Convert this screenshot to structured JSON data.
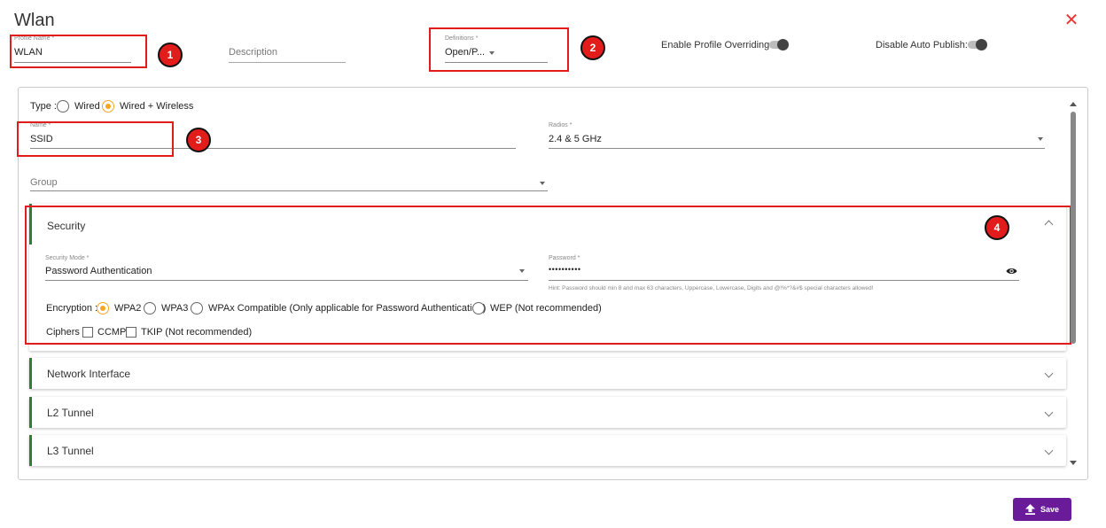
{
  "header": {
    "title": "Wlan",
    "close_glyph": "✕"
  },
  "profile_name": {
    "label": "Profile Name *",
    "value": "WLAN"
  },
  "description": {
    "placeholder": "Description"
  },
  "definitions": {
    "label": "Definitions *",
    "value": "Open/P..."
  },
  "toggles": {
    "profile_overriding": {
      "label": "Enable Profile Overriding:",
      "on": false
    },
    "auto_publish": {
      "label": "Disable Auto Publish:",
      "on": false
    }
  },
  "badges": [
    "1",
    "2",
    "3",
    "4"
  ],
  "type_row": {
    "label": "Type :",
    "options": [
      {
        "label": "Wired",
        "selected": false
      },
      {
        "label": "Wired + Wireless",
        "selected": true
      }
    ]
  },
  "name_field": {
    "label": "Name *",
    "value": "SSID"
  },
  "radios_field": {
    "label": "Radios *",
    "value": "2.4 & 5 GHz"
  },
  "group_field": {
    "placeholder": "Group"
  },
  "security": {
    "title": "Security",
    "mode_label": "Security Mode *",
    "mode_value": "Password Authentication",
    "password_label": "Password *",
    "password_value": "••••••••••",
    "password_hint": "Hint: Password should min 8 and max 63 characters, Uppercase, Lowercase, Digits and @!%*?&#$ special characters allowed!",
    "encryption_label": "Encryption :",
    "encryption_options": [
      {
        "label": "WPA2",
        "selected": true
      },
      {
        "label": "WPA3",
        "selected": false
      },
      {
        "label": "WPAx Compatible (Only applicable for Password Authentication)",
        "selected": false
      },
      {
        "label": "WEP (Not recommended)",
        "selected": false
      }
    ],
    "ciphers_label": "Ciphers :",
    "cipher_options": [
      {
        "label": "CCMP",
        "checked": false
      },
      {
        "label": "TKIP (Not recommended)",
        "checked": false
      }
    ]
  },
  "sections": [
    {
      "title": "Network Interface"
    },
    {
      "title": "L2 Tunnel"
    },
    {
      "title": "L3 Tunnel"
    }
  ],
  "save": {
    "label": "Save",
    "icon": "upload-icon"
  },
  "colors": {
    "accent_orange": "#f5a623",
    "annotation_red": "#e21b1b",
    "section_green": "#2e7d32",
    "save_purple": "#6a1b9a",
    "close_red": "#e53935"
  }
}
